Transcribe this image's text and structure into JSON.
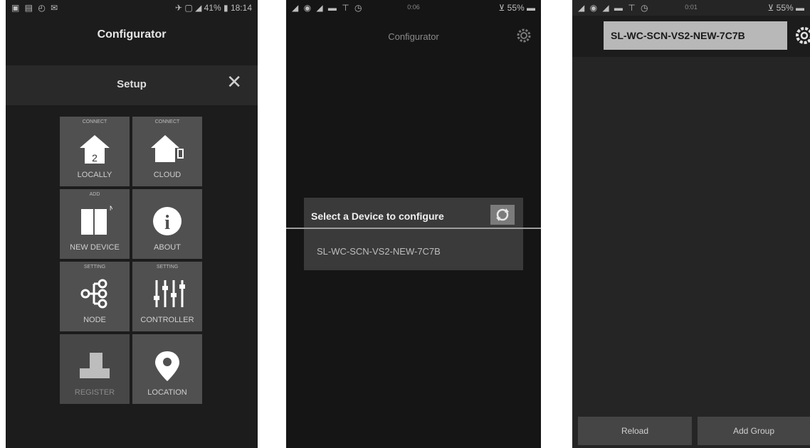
{
  "phone1": {
    "status": {
      "left": "▣ ▤ ◴ ✉",
      "right": "✈ ▢ ◢ 41% ▮ 18:14"
    },
    "title": "Configurator",
    "header": {
      "title": "Setup",
      "close": "✕"
    },
    "tiles": [
      {
        "top": "CONNECT",
        "label": "LOCALLY",
        "icon": "home-local-icon"
      },
      {
        "top": "CONNECT",
        "label": "CLOUD",
        "icon": "home-cloud-icon"
      },
      {
        "top": "ADD",
        "label": "NEW DEVICE",
        "icon": "new-device-icon"
      },
      {
        "top": "",
        "label": "ABOUT",
        "icon": "info-icon"
      },
      {
        "top": "SETTING",
        "label": "NODE",
        "icon": "node-icon"
      },
      {
        "top": "SETTING",
        "label": "CONTROLLER",
        "icon": "controller-icon"
      },
      {
        "top": "",
        "label": "REGISTER",
        "icon": "register-icon"
      },
      {
        "top": "",
        "label": "LOCATION",
        "icon": "location-icon"
      }
    ]
  },
  "phone2": {
    "status": {
      "left": "◢ ◉ ◢ ▬ ⊤ ◷",
      "center": "0:06",
      "right": "⊻ 55% ▬"
    },
    "title": "Configurator",
    "dialog": {
      "title": "Select a Device to configure",
      "device": "SL-WC-SCN-VS2-NEW-7C7B"
    }
  },
  "phone3": {
    "status": {
      "left": "◢ ◉ ◢ ▬ ⊤ ◷",
      "center": "0:01",
      "right": "⊻ 55% ▬"
    },
    "device": "SL-WC-SCN-VS2-NEW-7C7B",
    "buttons": {
      "reload": "Reload",
      "add_group": "Add Group"
    }
  }
}
